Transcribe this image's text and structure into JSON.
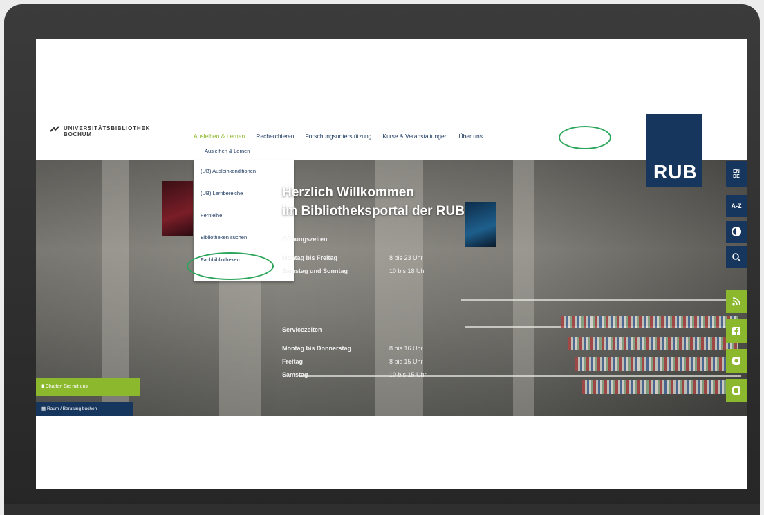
{
  "header": {
    "logo_line1": "UNIVERSITÄTSBIBLIOTHEK",
    "logo_line2": "BOCHUM",
    "nav": [
      "Ausleihen & Lernen",
      "Recherchieren",
      "Forschungsunterstützung",
      "Kurse & Veranstaltungen",
      "Über uns"
    ],
    "brand": "RUB"
  },
  "dropdown": {
    "header": "Ausleihen & Lernen",
    "items": [
      "(UB) Ausleihkonditionen",
      "(UB) Lernbereiche",
      "Fernleihe",
      "Bibliotheken suchen",
      "Fachbibliotheken"
    ]
  },
  "sidebar": {
    "lang": [
      "EN",
      "DE"
    ],
    "az": "A-Z",
    "icons": [
      "contrast-icon",
      "search-icon",
      "rss-icon",
      "facebook-icon",
      "instagram-icon",
      "other-icon"
    ]
  },
  "hero": {
    "line1": "Herzlich Willkommen",
    "line2": "im Bibliotheksportal der RUB",
    "opening_heading": "Öffnungszeiten",
    "opening": [
      {
        "day": "Montag bis Freitag",
        "time": "8 bis 23 Uhr"
      },
      {
        "day": "Samstag und Sonntag",
        "time": "10 bis 18 Uhr"
      }
    ],
    "service_heading": "Servicezeiten",
    "service": [
      {
        "day": "Montag bis Donnerstag",
        "time": "8 bis 16 Uhr"
      },
      {
        "day": "Freitag",
        "time": "8 bis 15 Uhr"
      },
      {
        "day": "Samstag",
        "time": "10 bis 15 Uhr"
      }
    ],
    "btn_green": "Chatten Sie mit uns",
    "btn_blue": "Raum / Beratung buchen"
  },
  "colors": {
    "accent_blue": "#17365d",
    "accent_green": "#8cb82d",
    "highlight_circle": "#2aa55a"
  }
}
